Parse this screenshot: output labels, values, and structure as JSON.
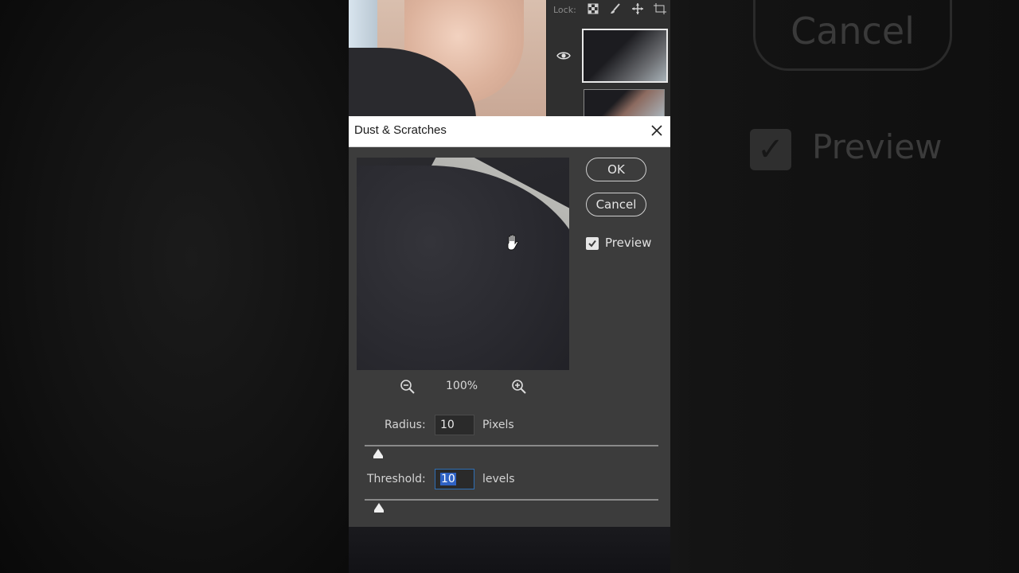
{
  "background": {
    "ghost_cancel_label": "Cancel",
    "ghost_preview_label": "Preview"
  },
  "layers_panel": {
    "lock_label": "Lock:",
    "lock_icons": [
      "lock-transparent-icon",
      "lock-brush-icon",
      "lock-position-icon",
      "lock-artboard-icon"
    ]
  },
  "dialog": {
    "title": "Dust & Scratches",
    "ok_label": "OK",
    "cancel_label": "Cancel",
    "preview_label": "Preview",
    "preview_checked": true,
    "zoom_level": "100%",
    "radius": {
      "label": "Radius:",
      "value": "10",
      "unit": "Pixels"
    },
    "threshold": {
      "label": "Threshold:",
      "value": "10",
      "unit": "levels"
    },
    "accent_color": "#2f62c4"
  }
}
